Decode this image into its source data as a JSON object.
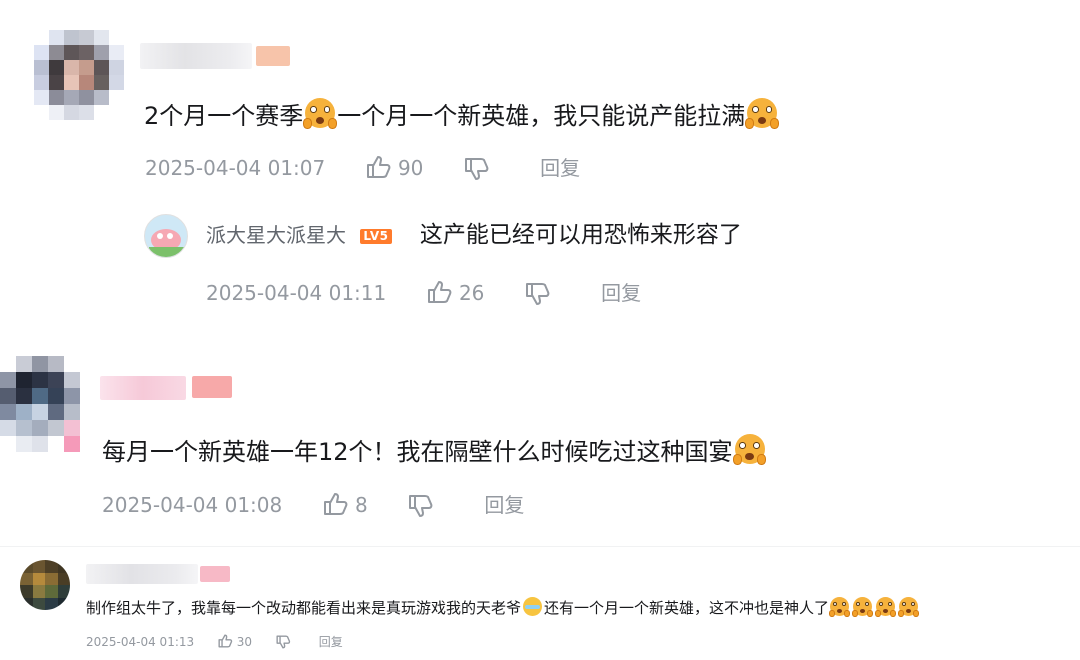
{
  "comments": [
    {
      "content_part1": "2个月一个赛季",
      "content_part2": "一个月一个新英雄，我只能说产能拉满",
      "emoji_1": "shocked-emoji",
      "emoji_2": "shocked-emoji",
      "time": "2025-04-04 01:07",
      "likes": "90",
      "reply_label": "回复",
      "reply": {
        "username": "派大星大派星大",
        "level_badge": "LV5",
        "content": "这产能已经可以用恐怖来形容了",
        "time": "2025-04-04 01:11",
        "likes": "26",
        "reply_label": "回复"
      }
    },
    {
      "content": "每月一个新英雄一年12个！我在隔壁什么时候吃过这种国宴",
      "emoji_1": "shocked-emoji",
      "time": "2025-04-04 01:08",
      "likes": "8",
      "reply_label": "回复"
    },
    {
      "content_part1": "制作组太牛了，我靠每一个改动都能看出来是真玩游戏我的天老爷",
      "content_part2": "还有一个月一个新英雄，这不冲也是神人了",
      "emoji_laugh": "laughing-tears-emoji",
      "emoji_end": [
        "shocked-emoji",
        "shocked-emoji",
        "shocked-emoji",
        "shocked-emoji"
      ],
      "time": "2025-04-04 01:13",
      "likes": "30",
      "reply_label": "回复"
    }
  ],
  "colors": {
    "text": "#18191c",
    "meta": "#9499a0",
    "username_blur": "#e8e8ec",
    "level_badge": "#ff7b2c"
  }
}
